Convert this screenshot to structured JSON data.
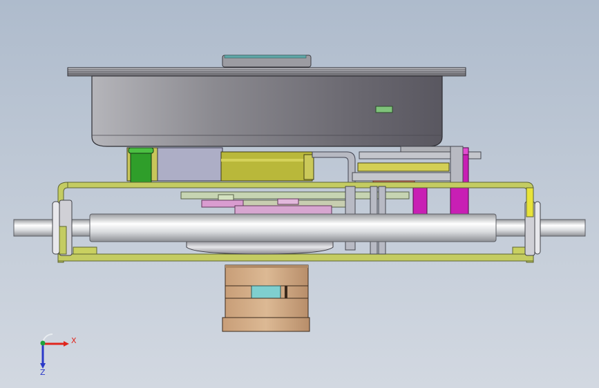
{
  "triad": {
    "x_label": "X",
    "z_label": "Z",
    "x_color": "#e0251d",
    "z_color": "#2a38c8",
    "y_color": "#1fa33a"
  },
  "palette": {
    "pan_dark": "#6e6c72",
    "pan_light": "#9a9aa0",
    "frame": "#c4cc62",
    "frame_edge": "#5c6330",
    "shaft": "#e6e8ea",
    "bearing": "#cda882",
    "magenta": "#c81fb4",
    "green": "#2fa12f",
    "yellow": "#c6c23d",
    "cyan": "#79c8c8"
  }
}
